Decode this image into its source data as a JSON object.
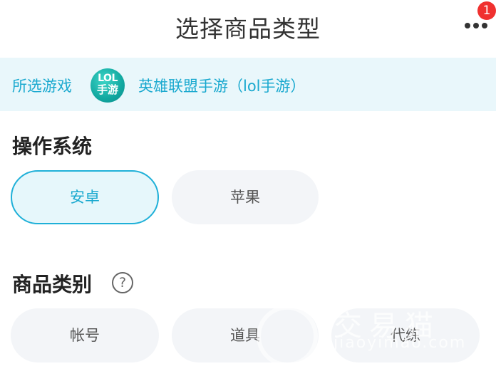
{
  "header": {
    "title": "选择商品类型",
    "badge_count": "1",
    "more_icon": "more-dots-icon"
  },
  "selected_game": {
    "label": "所选游戏",
    "logo_text_top": "LOL",
    "logo_text_bottom": "手游",
    "game_name": "英雄联盟手游（lol手游）"
  },
  "os_section": {
    "title": "操作系统",
    "options": [
      {
        "label": "安卓",
        "selected": true
      },
      {
        "label": "苹果",
        "selected": false
      }
    ]
  },
  "category_section": {
    "title": "商品类别",
    "help_icon": "question-circle-icon",
    "help_glyph": "?",
    "options": [
      {
        "label": "帐号"
      },
      {
        "label": "道具"
      },
      {
        "label": "代练"
      }
    ]
  },
  "watermark": {
    "text": "交易猫",
    "url": "jiaoyimao.com"
  },
  "colors": {
    "accent": "#1aa9cf",
    "badge": "#f0312f",
    "pill_bg": "#f3f5f8",
    "game_bar_bg": "#e9f7fb"
  }
}
